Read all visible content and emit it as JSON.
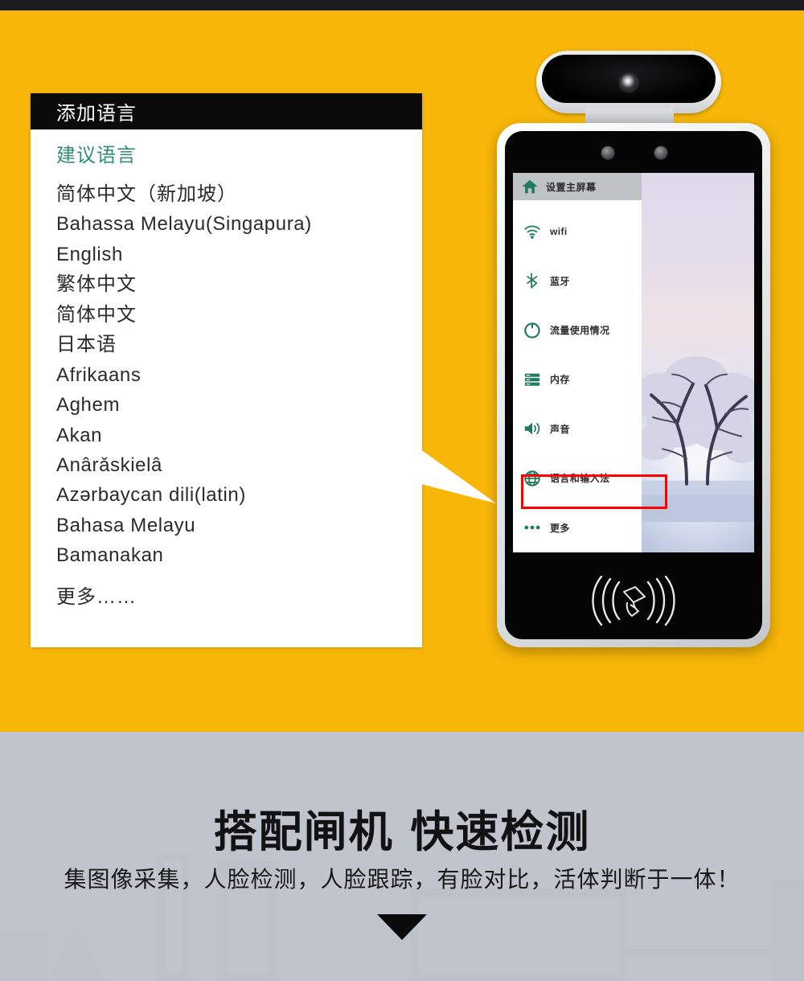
{
  "colors": {
    "hero_yellow": "#F7B608",
    "panel_header_bg": "#0b0b0b",
    "suggest_green": "#2f8f74",
    "menu_icon_green": "#1f7a5e",
    "highlight_red": "#ff0000",
    "gray_section": "#c0c4cc",
    "top_strip": "#1d1d1f"
  },
  "language_panel": {
    "title": "添加语言",
    "suggest_label": "建议语言",
    "languages": [
      "简体中文（新加坡）",
      "Bahassa Melayu(Singapura)",
      "English",
      "繁体中文",
      "简体中文",
      "日本语",
      "Afrikaans",
      "Aghem",
      "Akan",
      "Anârǎskielâ",
      "Azərbaycan dili(latin)",
      "Bahasa Melayu",
      "Bamanakan"
    ],
    "more_label": "更多……"
  },
  "device": {
    "camera_module": "camera-module",
    "camera_lens": "camera-lens",
    "sensors": [
      "ir-sensor-left",
      "ir-sensor-right"
    ],
    "card_reader_icon": "rfid-card-reader-icon",
    "wallpaper": "winter-tree-wallpaper",
    "settings_menu": {
      "header": {
        "label": "设置主屏幕",
        "icon": "home-icon"
      },
      "items": [
        {
          "label": "wifi",
          "icon": "wifi-icon",
          "highlighted": false
        },
        {
          "label": "蓝牙",
          "icon": "bluetooth-icon",
          "highlighted": false
        },
        {
          "label": "流量使用情况",
          "icon": "data-usage-icon",
          "highlighted": false
        },
        {
          "label": "内存",
          "icon": "storage-icon",
          "highlighted": false
        },
        {
          "label": "声音",
          "icon": "sound-icon",
          "highlighted": false
        },
        {
          "label": "语言和输入法",
          "icon": "globe-icon",
          "highlighted": true
        },
        {
          "label": "更多",
          "icon": "more-dots-icon",
          "highlighted": false
        }
      ]
    }
  },
  "footer": {
    "headline": "搭配闸机 快速检测",
    "subline": "集图像采集，人脸检测，人脸跟踪，有脸对比，活体判断于一体！",
    "scroll_hint_icon": "down-triangle-icon"
  }
}
